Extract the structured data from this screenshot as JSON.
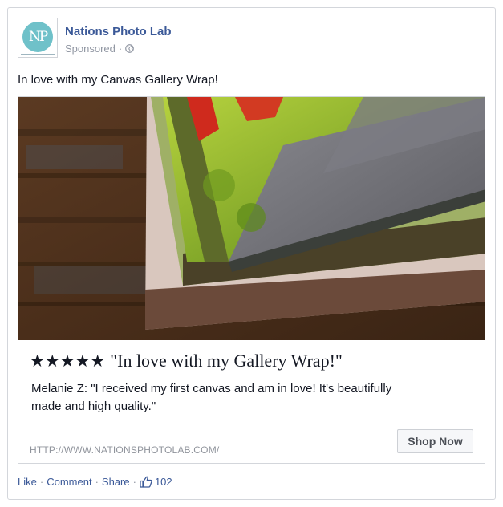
{
  "ad": {
    "page_name": "Nations Photo Lab",
    "avatar_initials": "NP",
    "sponsored_label": "Sponsored",
    "dot_separator": "·",
    "post_text": "In love with my Canvas Gallery Wrap!"
  },
  "attachment": {
    "rating_stars": "★★★★★",
    "rating_value": 5,
    "headline": "\"In love with my Gallery Wrap!\"",
    "description": "Melanie Z: \"I received my first canvas and am in love! It's beautifully made and high quality.\"",
    "url": "HTTP://WWW.NATIONSPHOTOLAB.COM/",
    "cta_label": "Shop Now"
  },
  "actions": {
    "like_label": "Like",
    "comment_label": "Comment",
    "share_label": "Share",
    "separator": "·",
    "like_count": "102"
  },
  "colors": {
    "link_blue": "#3b5998",
    "text": "#141823",
    "muted": "#9197a3",
    "logo_teal": "#6fc1c9"
  },
  "icons": {
    "privacy": "globe-icon",
    "likes": "thumbs-up-icon"
  }
}
